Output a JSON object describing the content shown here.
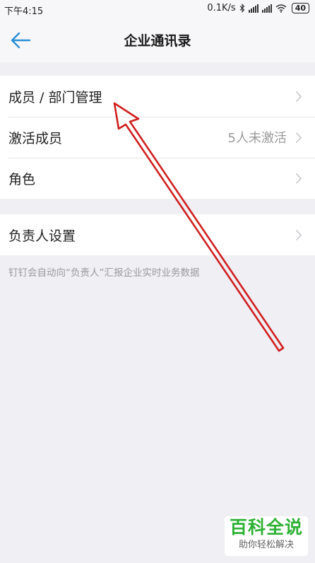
{
  "status_bar": {
    "time": "下午4:15",
    "network_speed": "0.1K/s",
    "icons": [
      "bluetooth-icon",
      "signal-icon",
      "signal-icon",
      "wifi-icon"
    ],
    "battery": "40"
  },
  "nav": {
    "title": "企业通讯录",
    "back_icon": "arrow-left-icon"
  },
  "section_1": [
    {
      "label": "成员 / 部门管理",
      "value": ""
    },
    {
      "label": "激活成员",
      "value": "5人未激活"
    },
    {
      "label": "角色",
      "value": ""
    }
  ],
  "section_2": [
    {
      "label": "负责人设置",
      "value": ""
    }
  ],
  "hint": "钉钉会自动向“负责人”汇报企业实时业务数据",
  "watermark": {
    "title": "百科全说",
    "subtitle": "助你轻松解决"
  },
  "colors": {
    "accent": "#2a8ed9",
    "annotation_arrow": "#d11f1f",
    "watermark_green": "#2eb135",
    "background": "#efeff4"
  }
}
